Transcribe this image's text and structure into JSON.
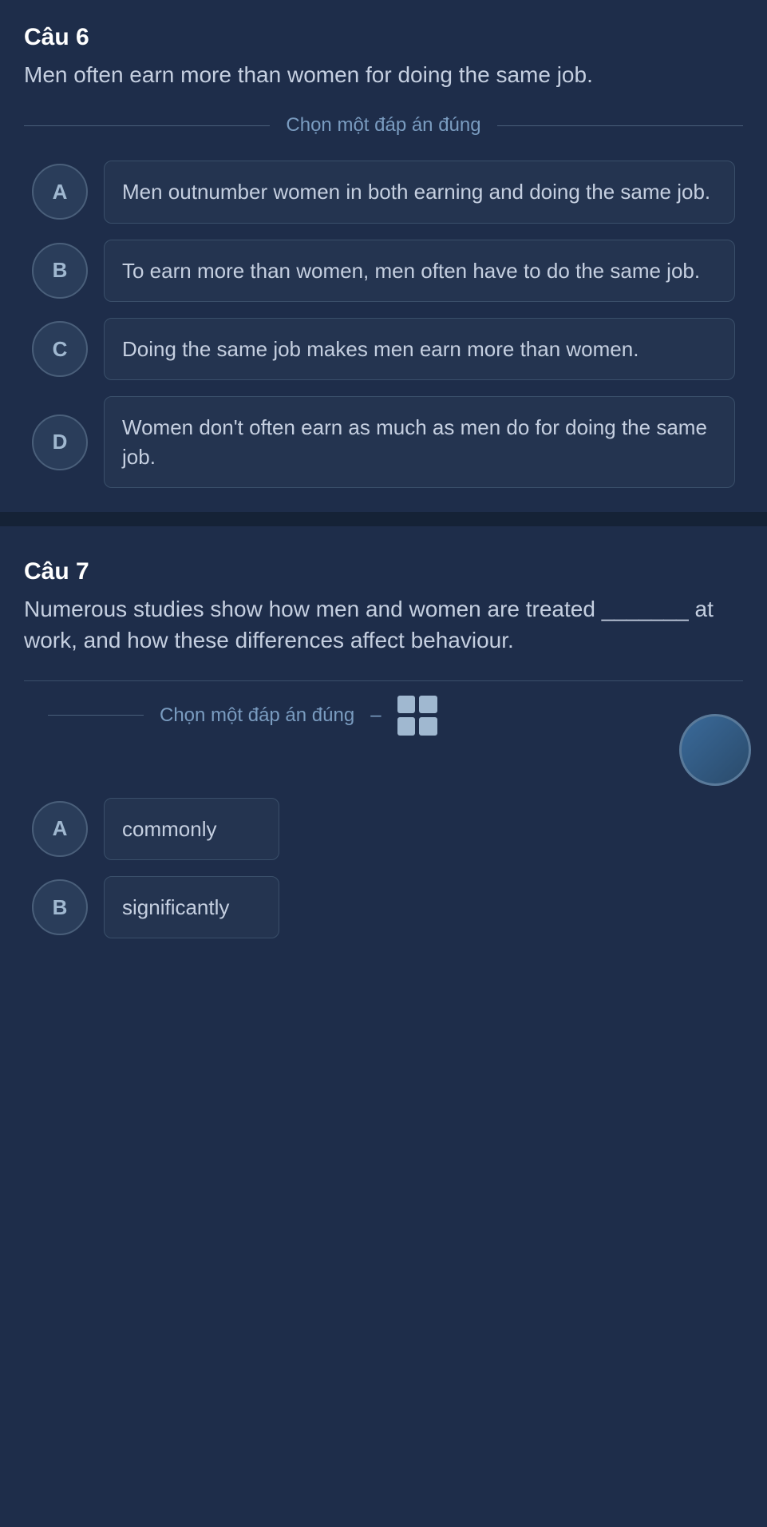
{
  "question6": {
    "number": "Câu 6",
    "text": "Men often earn more than women for doing the same job.",
    "divider_label": "Chọn một đáp án đúng",
    "options": [
      {
        "letter": "A",
        "text": "Men outnumber women in both earning and doing the same job."
      },
      {
        "letter": "B",
        "text": "To earn more than women, men often have to do the same job."
      },
      {
        "letter": "C",
        "text": "Doing the same job makes men earn more than women."
      },
      {
        "letter": "D",
        "text": "Women don't often earn as much as men do for doing the same job."
      }
    ]
  },
  "question7": {
    "number": "Câu 7",
    "text": "Numerous studies show how men and women are treated _______ at work, and how these differences affect behaviour.",
    "divider_label": "Chọn một đáp án đúng",
    "options": [
      {
        "letter": "A",
        "text": "commonly"
      },
      {
        "letter": "B",
        "text": "significantly"
      }
    ]
  },
  "icons": {
    "grid": "grid-icon",
    "arrow": "►"
  },
  "colors": {
    "bg_dark": "#1e2d4a",
    "bg_card": "#243450",
    "text_primary": "#ffffff",
    "text_secondary": "#c5cfe0",
    "text_muted": "#7a9cc0",
    "border": "#3a4f6a",
    "circle_bg": "#2a3d5a"
  }
}
